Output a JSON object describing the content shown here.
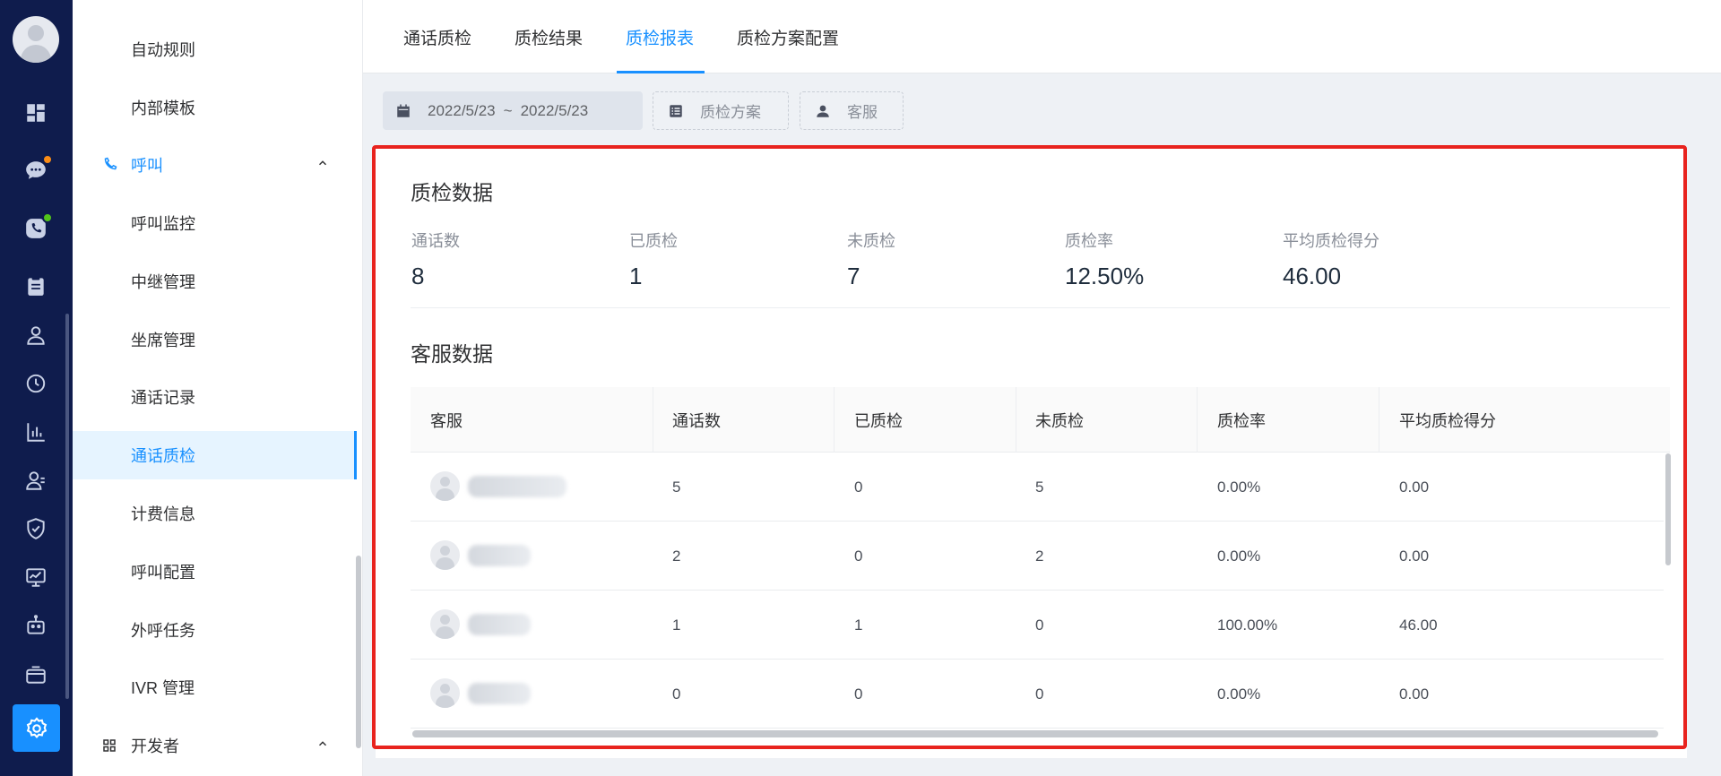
{
  "rail": {
    "icons": [
      "dashboard-icon",
      "chat-icon",
      "phone-icon",
      "clipboard-icon",
      "user-icon",
      "history-icon",
      "bar-chart-icon",
      "contacts-icon",
      "shield-icon",
      "monitor-icon",
      "robot-icon",
      "mailbox-icon",
      "settings-icon"
    ],
    "badge_colors": [
      "#fa8c16",
      "#52c41a"
    ],
    "active_color": "#1890ff"
  },
  "menu": {
    "items": [
      {
        "label": "自动规则",
        "type": "item"
      },
      {
        "label": "内部模板",
        "type": "item"
      },
      {
        "label": "呼叫",
        "type": "group",
        "icon": "phone-icon",
        "expanded": true
      },
      {
        "label": "呼叫监控",
        "type": "item"
      },
      {
        "label": "中继管理",
        "type": "item"
      },
      {
        "label": "坐席管理",
        "type": "item"
      },
      {
        "label": "通话记录",
        "type": "item"
      },
      {
        "label": "通话质检",
        "type": "item",
        "active": true
      },
      {
        "label": "计费信息",
        "type": "item"
      },
      {
        "label": "呼叫配置",
        "type": "item"
      },
      {
        "label": "外呼任务",
        "type": "item"
      },
      {
        "label": "IVR 管理",
        "type": "item"
      },
      {
        "label": "开发者",
        "type": "group",
        "icon": "grid-icon",
        "expanded": true
      }
    ]
  },
  "tabs": [
    {
      "label": "通话质检"
    },
    {
      "label": "质检结果"
    },
    {
      "label": "质检报表",
      "active": true
    },
    {
      "label": "质检方案配置"
    }
  ],
  "filters": {
    "date_start": "2022/5/23",
    "date_sep": "~",
    "date_end": "2022/5/23",
    "plan_placeholder": "质检方案",
    "agent_placeholder": "客服"
  },
  "qc_data": {
    "title": "质检数据",
    "stats": [
      {
        "label": "通话数",
        "value": "8"
      },
      {
        "label": "已质检",
        "value": "1"
      },
      {
        "label": "未质检",
        "value": "7"
      },
      {
        "label": "质检率",
        "value": "12.50%"
      },
      {
        "label": "平均质检得分",
        "value": "46.00"
      }
    ]
  },
  "agent_data": {
    "title": "客服数据",
    "columns": [
      "客服",
      "通话数",
      "已质检",
      "未质检",
      "质检率",
      "平均质检得分"
    ],
    "rows": [
      {
        "calls": "5",
        "checked": "0",
        "unchecked": "5",
        "rate": "0.00%",
        "score": "0.00"
      },
      {
        "calls": "2",
        "checked": "0",
        "unchecked": "2",
        "rate": "0.00%",
        "score": "0.00"
      },
      {
        "calls": "1",
        "checked": "1",
        "unchecked": "0",
        "rate": "100.00%",
        "score": "46.00"
      },
      {
        "calls": "0",
        "checked": "0",
        "unchecked": "0",
        "rate": "0.00%",
        "score": "0.00"
      }
    ]
  },
  "colors": {
    "accent": "#1890ff",
    "highlight_border": "#e8231e",
    "rail_bg": "#0f1c4d"
  }
}
